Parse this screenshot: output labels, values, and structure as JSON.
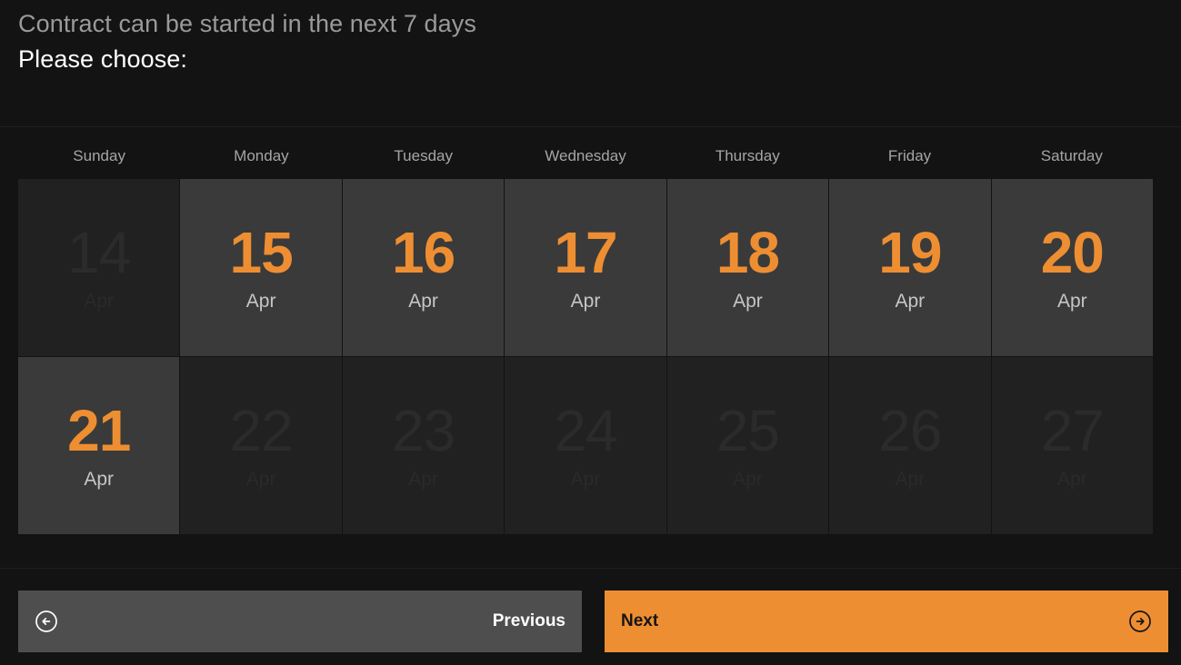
{
  "header": {
    "line1": "Contract can be started in the next 7 days",
    "line2": "Please choose:"
  },
  "calendar": {
    "weekdays": [
      {
        "label": "Sunday"
      },
      {
        "label": "Monday"
      },
      {
        "label": "Tuesday"
      },
      {
        "label": "Wednesday"
      },
      {
        "label": "Thursday"
      },
      {
        "label": "Friday"
      },
      {
        "label": "Saturday"
      }
    ],
    "days": [
      {
        "num": "14",
        "month": "Apr",
        "state": "disabled"
      },
      {
        "num": "15",
        "month": "Apr",
        "state": "enabled"
      },
      {
        "num": "16",
        "month": "Apr",
        "state": "enabled"
      },
      {
        "num": "17",
        "month": "Apr",
        "state": "enabled"
      },
      {
        "num": "18",
        "month": "Apr",
        "state": "enabled"
      },
      {
        "num": "19",
        "month": "Apr",
        "state": "enabled"
      },
      {
        "num": "20",
        "month": "Apr",
        "state": "enabled"
      },
      {
        "num": "21",
        "month": "Apr",
        "state": "enabled"
      },
      {
        "num": "22",
        "month": "Apr",
        "state": "disabled"
      },
      {
        "num": "23",
        "month": "Apr",
        "state": "disabled"
      },
      {
        "num": "24",
        "month": "Apr",
        "state": "disabled"
      },
      {
        "num": "25",
        "month": "Apr",
        "state": "disabled"
      },
      {
        "num": "26",
        "month": "Apr",
        "state": "disabled"
      },
      {
        "num": "27",
        "month": "Apr",
        "state": "disabled"
      }
    ]
  },
  "footer": {
    "previous": {
      "label": "Previous",
      "icon": "arrow-left-circle-icon"
    },
    "next": {
      "label": "Next",
      "icon": "arrow-right-circle-icon"
    }
  },
  "colors": {
    "page_background": "#131313",
    "accent_orange": "#ee8e32",
    "cell_enabled_background": "#3a3a3a",
    "cell_disabled_background": "#212121",
    "previous_button_background": "#4e4e4e",
    "header_muted_text": "#9a9a9a",
    "header_primary_text": "#ffffff"
  }
}
